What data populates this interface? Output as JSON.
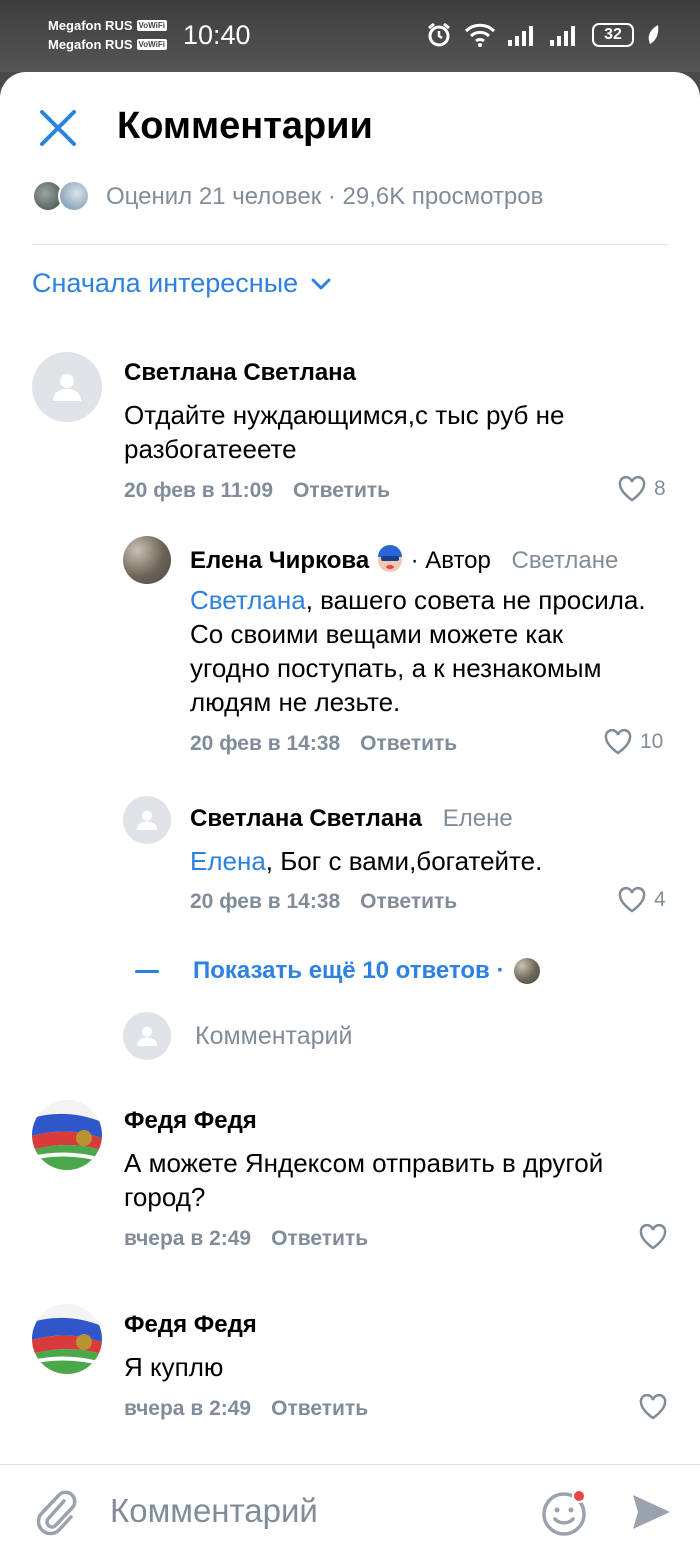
{
  "status_bar": {
    "carrier1": "Megafon RUS",
    "carrier2": "Megafon RUS",
    "vowifi": "VoWiFi",
    "time": "10:40",
    "battery": "32"
  },
  "header": {
    "title": "Комментарии"
  },
  "stats": {
    "text": "Оценил 21 человек · 29,6K просмотров"
  },
  "sort": {
    "label": "Сначала интересные"
  },
  "comments": [
    {
      "author": "Светлана Светлана",
      "text": "Отдайте нуждающимся,с тыс руб не разбогатееете",
      "time": "20 фев в 11:09",
      "reply_label": "Ответить",
      "likes": "8"
    },
    {
      "author": "Елена Чиркова",
      "author_tag": "· Автор",
      "reply_to": "Светлане",
      "mention": "Светлана",
      "text": ", вашего совета не просила. Со своими вещами можете как угодно поступать, а к незнакомым людям  не лезьте.",
      "time": "20 фев в 14:38",
      "reply_label": "Ответить",
      "likes": "10"
    },
    {
      "author": "Светлана Светлана",
      "reply_to": "Елене",
      "mention": "Елена",
      "text": ", Бог с вами,богатейте.",
      "time": "20 фев в 14:38",
      "reply_label": "Ответить",
      "likes": "4"
    },
    {
      "author": "Федя Федя",
      "text": "А можете Яндексом отправить в другой город?",
      "time": "вчера в 2:49",
      "reply_label": "Ответить",
      "likes": ""
    },
    {
      "author": "Федя Федя",
      "text": "Я куплю",
      "time": "вчера в 2:49",
      "reply_label": "Ответить",
      "likes": ""
    }
  ],
  "show_more": {
    "label": "Показать ещё 10 ответов ·"
  },
  "reply_input": {
    "placeholder": "Комментарий"
  },
  "composer": {
    "placeholder": "Комментарий"
  },
  "colors": {
    "accent": "#2d81e0",
    "secondary": "#818c99"
  }
}
